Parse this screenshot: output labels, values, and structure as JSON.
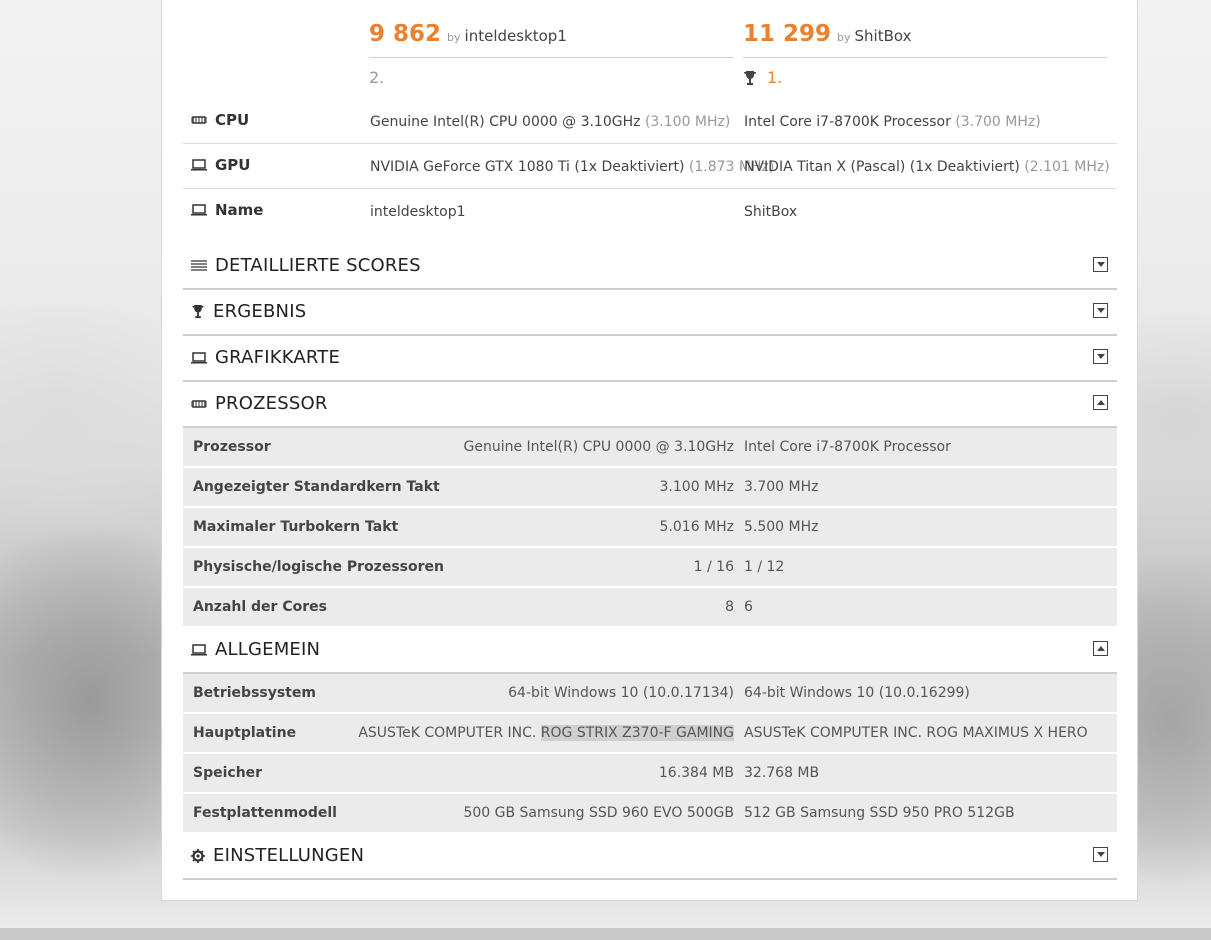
{
  "scores": [
    {
      "value": "9 862",
      "by": "by",
      "name": "inteldesktop1",
      "rank": "2.",
      "trophy": false
    },
    {
      "value": "11 299",
      "by": "by",
      "name": "ShitBox",
      "rank": "1.",
      "trophy": true
    }
  ],
  "system": [
    {
      "label": "CPU",
      "icon": "cpu-icon",
      "v1": "Genuine Intel(R) CPU 0000 @ 3.10GHz",
      "v1_extra": "(3.100 MHz)",
      "v2": "Intel Core i7-8700K Processor",
      "v2_extra": "(3.700 MHz)"
    },
    {
      "label": "GPU",
      "icon": "gpu-icon",
      "v1": "NVIDIA GeForce GTX 1080 Ti (1x Deaktiviert)",
      "v1_extra": "(1.873 MHz)",
      "v2": "NVIDIA Titan X (Pascal) (1x Deaktiviert)",
      "v2_extra": "(2.101 MHz)"
    },
    {
      "label": "Name",
      "icon": "laptop-icon",
      "v1": "inteldesktop1",
      "v1_extra": "",
      "v2": "ShitBox",
      "v2_extra": ""
    }
  ],
  "sections": {
    "detailed": {
      "title": "DETAILLIERTE SCORES",
      "expanded": false
    },
    "result": {
      "title": "ERGEBNIS",
      "expanded": false
    },
    "graphics": {
      "title": "GRAFIKKARTE",
      "expanded": false
    },
    "processor": {
      "title": "PROZESSOR",
      "expanded": true
    },
    "general": {
      "title": "ALLGEMEIN",
      "expanded": true
    },
    "settings": {
      "title": "EINSTELLUNGEN",
      "expanded": false
    }
  },
  "processor_rows": [
    {
      "key": "Prozessor",
      "a": "Genuine Intel(R) CPU 0000 @ 3.10GHz",
      "b": "Intel Core i7-8700K Processor"
    },
    {
      "key": "Angezeigter Standardkern Takt",
      "a": "3.100 MHz",
      "b": "3.700 MHz"
    },
    {
      "key": "Maximaler Turbokern Takt",
      "a": "5.016 MHz",
      "b": "5.500 MHz"
    },
    {
      "key": "Physische/logische Prozessoren",
      "a": "1 / 16",
      "b": "1 / 12"
    },
    {
      "key": "Anzahl der Cores",
      "a": "8",
      "b": "6"
    }
  ],
  "general_rows": [
    {
      "key": "Betriebssystem",
      "a": "64-bit Windows 10 (10.0.17134)",
      "b": "64-bit Windows 10 (10.0.16299)"
    },
    {
      "key": "Hauptplatine",
      "a_prefix": "ASUSTeK COMPUTER INC.",
      "a_highlight": "ROG STRIX Z370-F GAMING",
      "b": "ASUSTeK COMPUTER INC. ROG MAXIMUS X HERO"
    },
    {
      "key": "Speicher",
      "a": "16.384 MB",
      "b": "32.768 MB"
    },
    {
      "key": "Festplattenmodell",
      "a": "500 GB Samsung SSD 960 EVO 500GB",
      "b": "512 GB Samsung SSD 950 PRO 512GB"
    }
  ],
  "colors": {
    "accent": "#e9812f",
    "row_bg": "#ebebeb"
  }
}
